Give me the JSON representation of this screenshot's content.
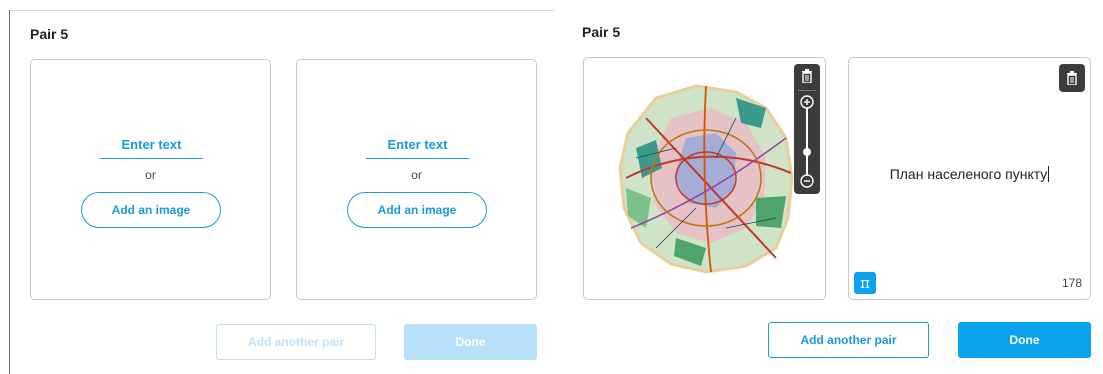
{
  "left_panel": {
    "title": "Pair 5",
    "cards": [
      {
        "enter_text": "Enter text",
        "or": "or",
        "add_image": "Add an image"
      },
      {
        "enter_text": "Enter text",
        "or": "or",
        "add_image": "Add an image"
      }
    ],
    "add_another_pair": "Add another pair",
    "done": "Done",
    "state": "disabled"
  },
  "right_panel": {
    "title": "Pair 5",
    "image_card": {
      "image": "city-plan-map",
      "toolbar_icons": [
        "trash-icon",
        "zoom-in-icon",
        "zoom-slider",
        "zoom-out-icon"
      ]
    },
    "text_card": {
      "text": "План населеного пункту",
      "char_count": "178",
      "math_button": "π",
      "trash_icon": "trash-icon"
    },
    "add_another_pair": "Add another pair",
    "done": "Done"
  },
  "colors": {
    "accent": "#0aa3ec",
    "link": "#1a9bd7",
    "disabled_fill": "#b7e1f8",
    "toolbar": "#3c3c3c"
  }
}
